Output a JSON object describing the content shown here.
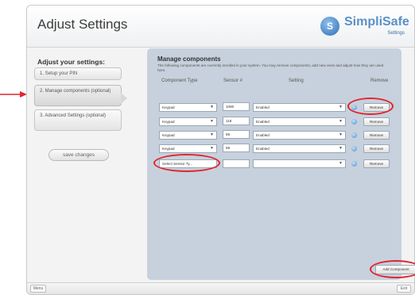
{
  "header": {
    "title": "Adjust Settings"
  },
  "logo": {
    "glyph": "S",
    "name": "SimpliSafe",
    "sub": "Settings"
  },
  "sidebar": {
    "heading": "Adjust your settings:",
    "steps": [
      {
        "label": "1. Setup your PIN"
      },
      {
        "label": "2. Manage components (optional)"
      },
      {
        "label": "3. Advanced Settings (optional)"
      }
    ],
    "save_label": "save changes"
  },
  "panel": {
    "title": "Manage components",
    "description": "The following components are currently enrolled in your system. You may remove components, add new ones and adjust how they are used here.",
    "columns": {
      "type": "Component Type",
      "serial": "Sensor #",
      "setting": "Setting",
      "remove": "Remove"
    },
    "rows": [
      {
        "type": "Keypad",
        "serial": "1080",
        "setting": "Enabled",
        "remove": "Remove"
      },
      {
        "type": "Keypad",
        "serial": "118",
        "setting": "Enabled",
        "remove": "Remove"
      },
      {
        "type": "Keypad",
        "serial": "59",
        "setting": "Enabled",
        "remove": "Remove"
      },
      {
        "type": "Keypad",
        "serial": "59",
        "setting": "Enabled",
        "remove": "Remove"
      },
      {
        "type": "Select Sensor Ty...",
        "serial": "",
        "setting": "",
        "remove": "Remove"
      }
    ],
    "add_label": "Add Component"
  },
  "footer": {
    "menu_label": "Menu",
    "exit_label": "Exit"
  },
  "colors": {
    "highlight": "#e0262e",
    "panel": "#c7d1dd",
    "accent": "#5a90c8"
  }
}
